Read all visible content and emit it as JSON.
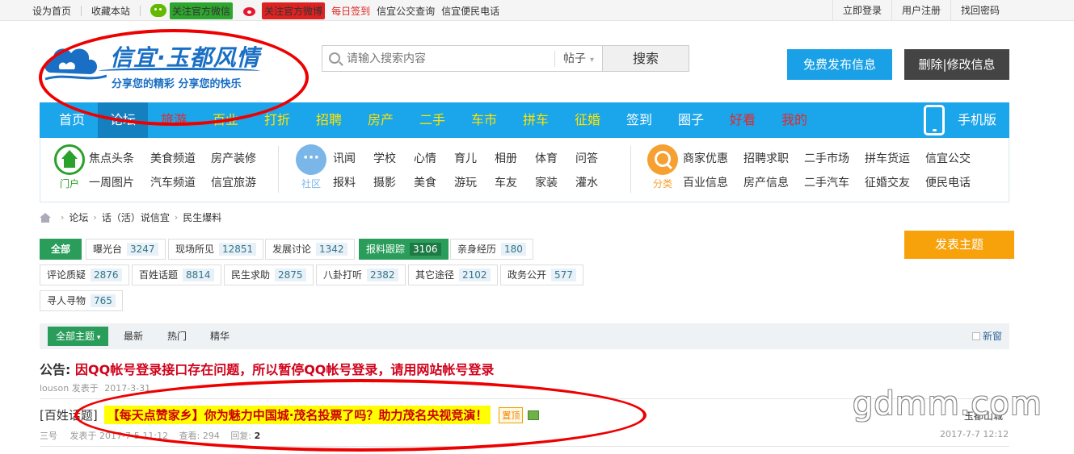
{
  "topbar": {
    "set_home": "设为首页",
    "favorite": "收藏本站",
    "wechat_follow": "关注官方微信",
    "weibo_follow": "关注官方微博",
    "daily_sign": "每日签到",
    "bus_query": "信宜公交查询",
    "phone_query": "信宜便民电话",
    "login": "立即登录",
    "register": "用户注册",
    "recover": "找回密码"
  },
  "logo": {
    "title": "信宜·玉都风情",
    "slogan": "分享您的精彩  分享您的快乐"
  },
  "search": {
    "placeholder": "请输入搜索内容",
    "type": "帖子",
    "button": "搜索"
  },
  "buttons": {
    "post_info": "免费发布信息",
    "edit_info": "删除|修改信息",
    "post_topic": "发表主题"
  },
  "nav": {
    "items": [
      "首页",
      "论坛",
      "旅游",
      "百业",
      "打折",
      "招聘",
      "房产",
      "二手",
      "车市",
      "拼车",
      "征婚",
      "签到",
      "圈子",
      "好看",
      "我的"
    ],
    "mobile": "手机版"
  },
  "subnav": {
    "portal": {
      "label": "门户",
      "links": [
        "焦点头条",
        "美食频道",
        "房产装修",
        "一周图片",
        "汽车频道",
        "信宜旅游"
      ]
    },
    "community": {
      "label": "社区",
      "links": [
        "讯闻",
        "学校",
        "心情",
        "育儿",
        "相册",
        "体育",
        "问答",
        "报料",
        "摄影",
        "美食",
        "游玩",
        "车友",
        "家装",
        "灌水"
      ]
    },
    "classify": {
      "label": "分类",
      "links": [
        "商家优惠",
        "招聘求职",
        "二手市场",
        "拼车货运",
        "信宜公交",
        "百业信息",
        "房产信息",
        "二手汽车",
        "征婚交友",
        "便民电话"
      ]
    }
  },
  "breadcrumb": [
    "论坛",
    "话（活）说信宜",
    "民生爆料"
  ],
  "forums": [
    {
      "name": "全部",
      "count": ""
    },
    {
      "name": "曝光台",
      "count": "3247"
    },
    {
      "name": "现场所见",
      "count": "12851"
    },
    {
      "name": "发展讨论",
      "count": "1342"
    },
    {
      "name": "报料跟踪",
      "count": "3106"
    },
    {
      "name": "亲身经历",
      "count": "180"
    },
    {
      "name": "评论质疑",
      "count": "2876"
    },
    {
      "name": "百姓话题",
      "count": "8814"
    },
    {
      "name": "民生求助",
      "count": "2875"
    },
    {
      "name": "八卦打听",
      "count": "2382"
    },
    {
      "name": "其它途径",
      "count": "2102"
    },
    {
      "name": "政务公开",
      "count": "577"
    },
    {
      "name": "寻人寻物",
      "count": "765"
    }
  ],
  "filter": {
    "all": "全部主题",
    "latest": "最新",
    "hot": "热门",
    "digest": "精华",
    "new_window": "新窗"
  },
  "notice": {
    "prefix": "公告:",
    "text": "因QQ帐号登录接口存在问题，所以暂停QQ帐号登录，请用网站帐号登录",
    "author": "louson",
    "posted": "发表于",
    "date": "2017-3-31"
  },
  "thread": {
    "category": "[百姓话题]",
    "title": "【每天点赞家乡】你为魅力中国城·茂名投票了吗？助力茂名央视竞演！",
    "stick": "置顶",
    "author": "三号",
    "posted": "发表于",
    "date": "2017-7-5 11:12",
    "views_label": "查看:",
    "views": "294",
    "replies_label": "回复:",
    "replies": "2",
    "last_author": "玉都山城",
    "last_date": "2017-7-7 12:12"
  },
  "watermark": "gdmm.com",
  "colors": {
    "nav": "#1ba5ea",
    "green": "#2a9d5a",
    "orange": "#f7a20b",
    "red_mark": "#e00000"
  }
}
